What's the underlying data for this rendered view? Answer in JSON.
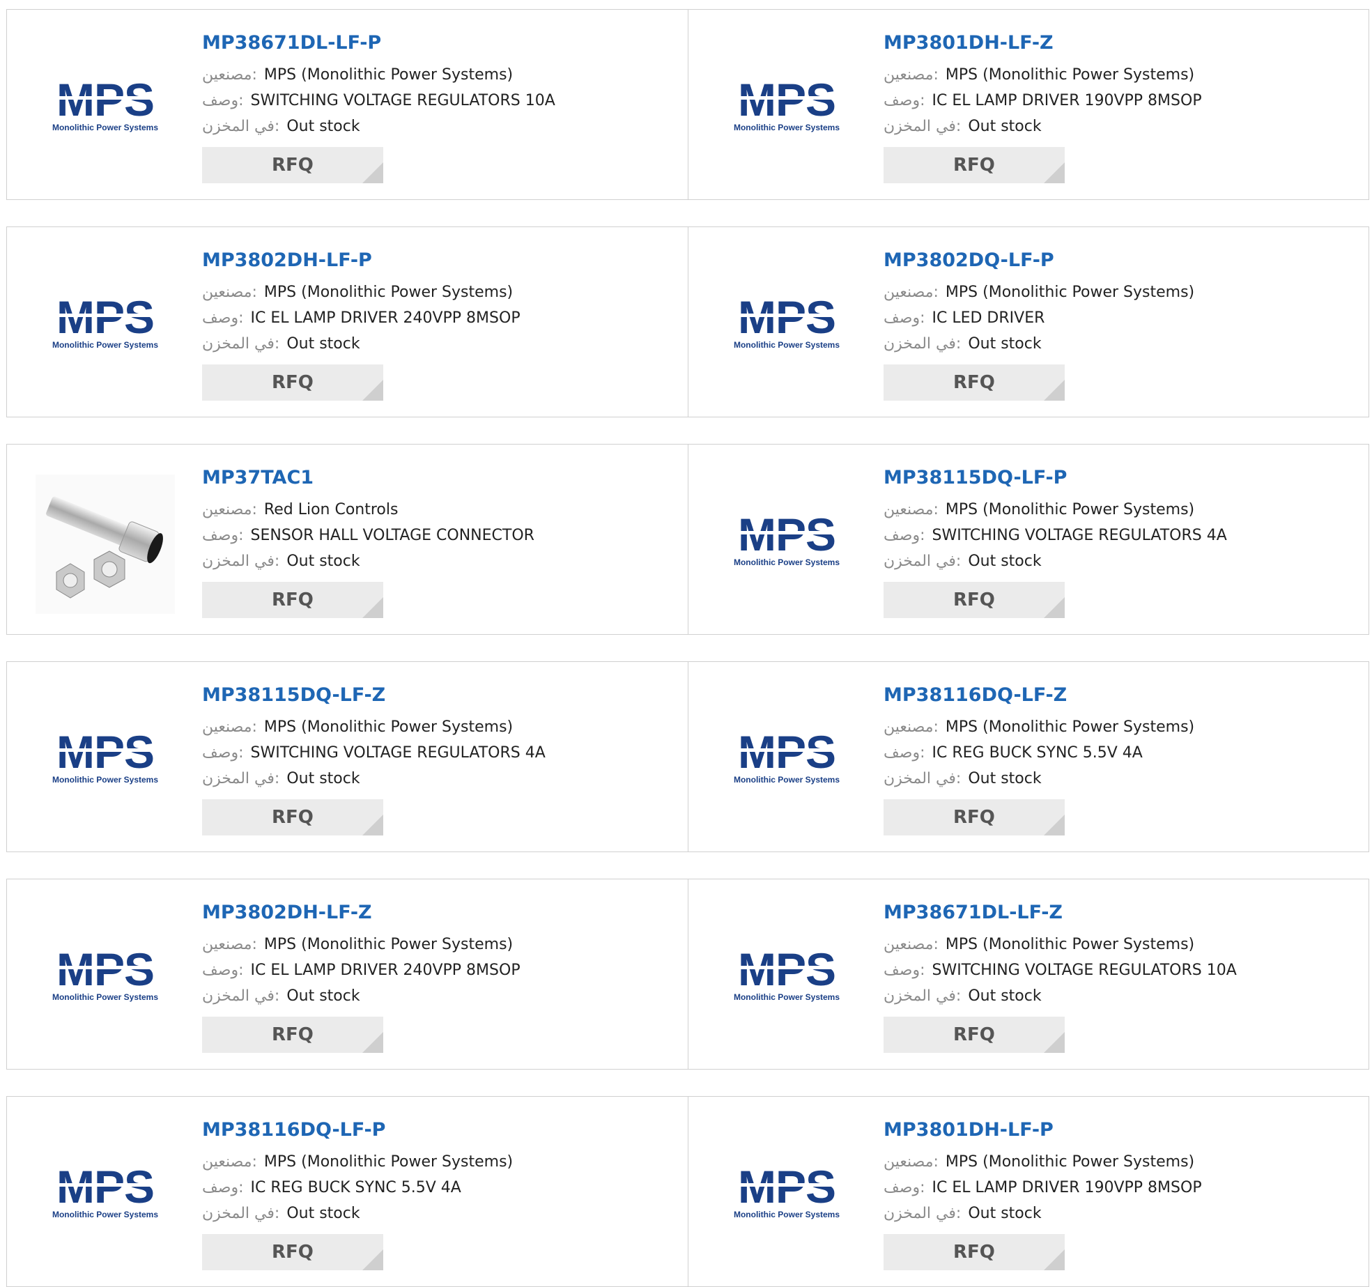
{
  "labels": {
    "manufacturer": "مصنعين:",
    "description": "وصف:",
    "stock": "في المخزن:"
  },
  "rfq_label": "RFQ",
  "logo": {
    "brand": "MPS",
    "tagline": "Monolithic Power Systems",
    "color": "#1a3f86"
  },
  "products": [
    {
      "part": "MP38671DL-LF-P",
      "manufacturer": "MPS (Monolithic Power Systems)",
      "description": "SWITCHING VOLTAGE REGULATORS 10A",
      "stock": "Out stock",
      "image": "mps-logo"
    },
    {
      "part": "MP3801DH-LF-Z",
      "manufacturer": "MPS (Monolithic Power Systems)",
      "description": "IC EL LAMP DRIVER 190VPP 8MSOP",
      "stock": "Out stock",
      "image": "mps-logo"
    },
    {
      "part": "MP3802DH-LF-P",
      "manufacturer": "MPS (Monolithic Power Systems)",
      "description": "IC EL LAMP DRIVER 240VPP 8MSOP",
      "stock": "Out stock",
      "image": "mps-logo"
    },
    {
      "part": "MP3802DQ-LF-P",
      "manufacturer": "MPS (Monolithic Power Systems)",
      "description": "IC LED DRIVER",
      "stock": "Out stock",
      "image": "mps-logo"
    },
    {
      "part": "MP37TAC1",
      "manufacturer": "Red Lion Controls",
      "description": "SENSOR HALL VOLTAGE CONNECTOR",
      "stock": "Out stock",
      "image": "sensor-photo"
    },
    {
      "part": "MP38115DQ-LF-P",
      "manufacturer": "MPS (Monolithic Power Systems)",
      "description": "SWITCHING VOLTAGE REGULATORS 4A",
      "stock": "Out stock",
      "image": "mps-logo"
    },
    {
      "part": "MP38115DQ-LF-Z",
      "manufacturer": "MPS (Monolithic Power Systems)",
      "description": "SWITCHING VOLTAGE REGULATORS 4A",
      "stock": "Out stock",
      "image": "mps-logo"
    },
    {
      "part": "MP38116DQ-LF-Z",
      "manufacturer": "MPS (Monolithic Power Systems)",
      "description": "IC REG BUCK SYNC 5.5V 4A",
      "stock": "Out stock",
      "image": "mps-logo"
    },
    {
      "part": "MP3802DH-LF-Z",
      "manufacturer": "MPS (Monolithic Power Systems)",
      "description": "IC EL LAMP DRIVER 240VPP 8MSOP",
      "stock": "Out stock",
      "image": "mps-logo"
    },
    {
      "part": "MP38671DL-LF-Z",
      "manufacturer": "MPS (Monolithic Power Systems)",
      "description": "SWITCHING VOLTAGE REGULATORS 10A",
      "stock": "Out stock",
      "image": "mps-logo"
    },
    {
      "part": "MP38116DQ-LF-P",
      "manufacturer": "MPS (Monolithic Power Systems)",
      "description": "IC REG BUCK SYNC 5.5V 4A",
      "stock": "Out stock",
      "image": "mps-logo"
    },
    {
      "part": "MP3801DH-LF-P",
      "manufacturer": "MPS (Monolithic Power Systems)",
      "description": "IC EL LAMP DRIVER 190VPP 8MSOP",
      "stock": "Out stock",
      "image": "mps-logo"
    }
  ]
}
